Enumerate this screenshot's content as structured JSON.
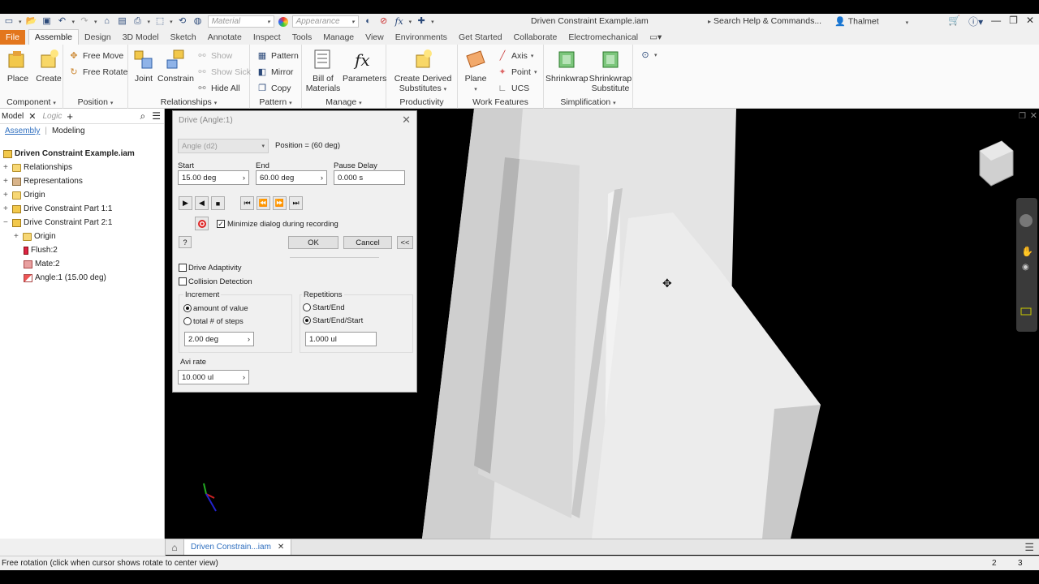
{
  "app": {
    "window_title": "Driven Constraint Example.iam",
    "search_placeholder": "Search Help & Commands...",
    "user": "Thalmet",
    "material_combo": "Material",
    "appearance_combo": "Appearance",
    "fx_symbol": "fx"
  },
  "ribbon_tabs": [
    "File",
    "Assemble",
    "Design",
    "3D Model",
    "Sketch",
    "Annotate",
    "Inspect",
    "Tools",
    "Manage",
    "View",
    "Environments",
    "Get Started",
    "Collaborate",
    "Electromechanical"
  ],
  "ribbon": {
    "component": {
      "label": "Component",
      "place": "Place",
      "create": "Create"
    },
    "position": {
      "label": "Position",
      "free_move": "Free Move",
      "free_rotate": "Free Rotate"
    },
    "relationships": {
      "label": "Relationships",
      "joint": "Joint",
      "constrain": "Constrain",
      "show": "Show",
      "show_sick": "Show Sick",
      "hide_all": "Hide All"
    },
    "pattern": {
      "label": "Pattern",
      "pattern": "Pattern",
      "mirror": "Mirror",
      "copy": "Copy"
    },
    "manage": {
      "label": "Manage",
      "bom_line1": "Bill of",
      "bom_line2": "Materials",
      "parameters": "Parameters"
    },
    "productivity": {
      "label": "Productivity",
      "derived_line1": "Create Derived",
      "derived_line2": "Substitutes"
    },
    "work_features": {
      "label": "Work Features",
      "plane": "Plane",
      "axis": "Axis",
      "point": "Point",
      "ucs": "UCS"
    },
    "simplification": {
      "label": "Simplification",
      "shrinkwrap": "Shrinkwrap",
      "shrinkwrap_sub_line1": "Shrinkwrap",
      "shrinkwrap_sub_line2": "Substitute"
    }
  },
  "browser": {
    "tab_model": "Model",
    "tab_logic": "Logic",
    "sub_assembly": "Assembly",
    "sub_modeling": "Modeling",
    "tree": [
      {
        "label": "Driven Constraint Example.iam",
        "bold": true
      },
      {
        "label": "Relationships"
      },
      {
        "label": "Representations"
      },
      {
        "label": "Origin"
      },
      {
        "label": "Drive Constraint Part 1:1"
      },
      {
        "label": "Drive Constraint Part 2:1"
      },
      {
        "label": "Origin"
      },
      {
        "label": "Flush:2"
      },
      {
        "label": "Mate:2"
      },
      {
        "label": "Angle:1 (15.00 deg)"
      }
    ]
  },
  "dialog": {
    "title": "Drive (Angle:1)",
    "constraint_select": "Angle (d2)",
    "position": "Position = (60 deg)",
    "start_label": "Start",
    "start_value": "15.00 deg",
    "end_label": "End",
    "end_value": "60.00 deg",
    "pause_label": "Pause Delay",
    "pause_value": "0.000 s",
    "minimize_label": "Minimize dialog during recording",
    "ok": "OK",
    "cancel": "Cancel",
    "collapse": "<<",
    "drive_adaptivity": "Drive Adaptivity",
    "collision_detection": "Collision Detection",
    "increment_label": "Increment",
    "amount_of_value": "amount of value",
    "total_steps": "total # of steps",
    "increment_value": "2.00 deg",
    "repetitions_label": "Repetitions",
    "start_end": "Start/End",
    "start_end_start": "Start/End/Start",
    "repetitions_value": "1.000 ul",
    "avi_label": "Avi rate",
    "avi_value": "10.000 ul"
  },
  "doc_tab": "Driven Constrain...iam",
  "status": {
    "message": "Free rotation (click when cursor shows rotate to center view)",
    "num1": "2",
    "num2": "3"
  },
  "colors": {
    "file_tab": "#e3761d",
    "viewport_bg": "#000000",
    "model_light": "#e8e8e8",
    "model_shadow": "#b8b8b8"
  }
}
